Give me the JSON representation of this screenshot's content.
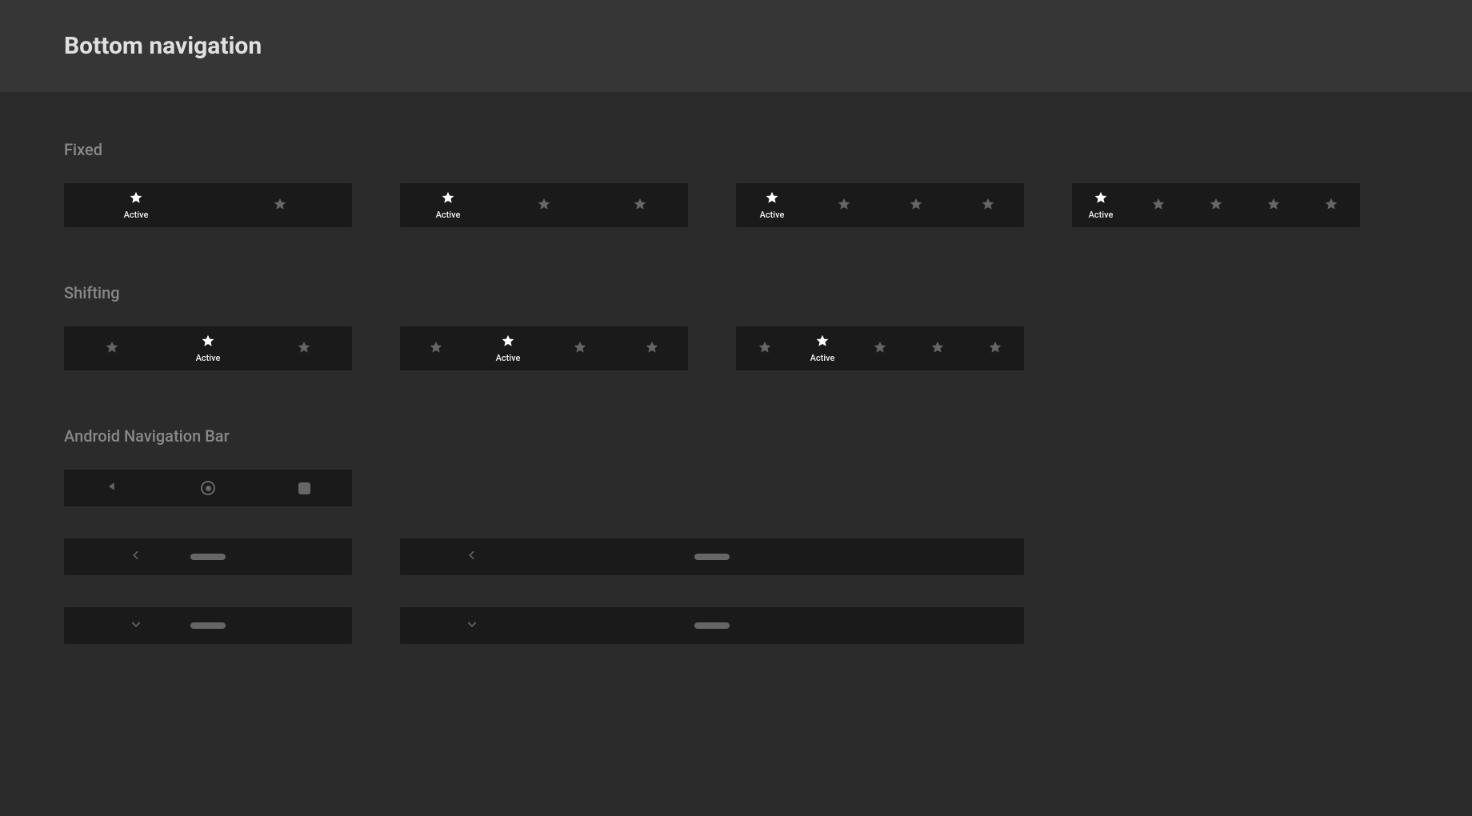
{
  "page": {
    "title": "Bottom navigation"
  },
  "sections": {
    "fixed": {
      "label": "Fixed"
    },
    "shifting": {
      "label": "Shifting"
    },
    "android": {
      "label": "Android Navigation Bar"
    }
  },
  "labels": {
    "active": "Active"
  },
  "icons": {
    "star": "star-icon",
    "backTriangle": "nav-back-triangle-icon",
    "homeCircle": "nav-home-circle-icon",
    "recentSquare": "nav-recent-square-icon",
    "chevronLeft": "chevron-left-icon",
    "chevronDown": "chevron-down-icon",
    "pill": "nav-pill-icon"
  },
  "fixedBars": [
    {
      "items": 2,
      "activeIndex": 0
    },
    {
      "items": 3,
      "activeIndex": 0
    },
    {
      "items": 4,
      "activeIndex": 0
    },
    {
      "items": 5,
      "activeIndex": 0
    }
  ],
  "shiftingBars": [
    {
      "items": 3,
      "activeIndex": 1
    },
    {
      "items": 4,
      "activeIndex": 1
    },
    {
      "items": 5,
      "activeIndex": 1
    }
  ],
  "colors": {
    "pageBg": "#2b2b2b",
    "headerBg": "#363636",
    "barBg": "#1a1a1a",
    "iconInactive": "#666666",
    "iconActive": "#ffffff",
    "sectionLabel": "#888888"
  }
}
